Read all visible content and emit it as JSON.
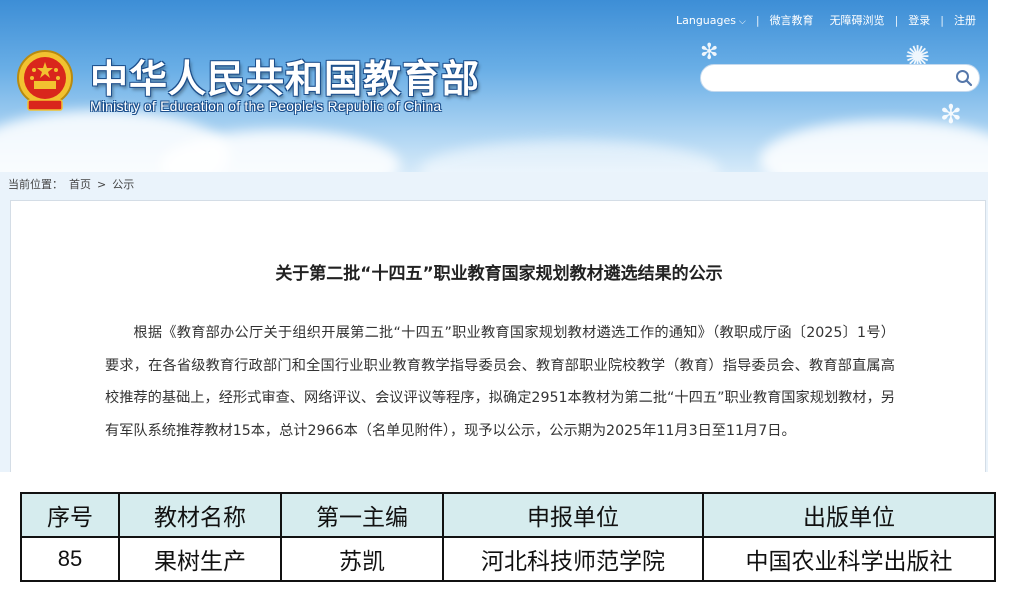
{
  "header": {
    "site_title": "中华人民共和国教育部",
    "site_subtitle": "Ministry of Education of the People's Republic of China",
    "nav": {
      "languages": "Languages",
      "weibo": "微言教育",
      "accessibility": "无障碍浏览",
      "login": "登录",
      "register": "注册"
    },
    "search": {
      "placeholder": ""
    }
  },
  "breadcrumb": {
    "label": "当前位置：",
    "home": "首页",
    "separator": ">",
    "current": "公示"
  },
  "article": {
    "title": "关于第二批“十四五”职业教育国家规划教材遴选结果的公示",
    "body": "根据《教育部办公厅关于组织开展第二批“十四五”职业教育国家规划教材遴选工作的通知》（教职成厅函〔2025〕1号）要求，在各省级教育行政部门和全国行业职业教育教学指导委员会、教育部职业院校教学（教育）指导委员会、教育部直属高校推荐的基础上，经形式审查、网络评议、会议评议等程序，拟确定2951本教材为第二批“十四五”职业教育国家规划教材，另有军队系统推荐教材15本，总计2966本（名单见附件），现予以公示，公示期为2025年11月3日至11月7日。"
  },
  "table": {
    "headers": [
      "序号",
      "教材名称",
      "第一主编",
      "申报单位",
      "出版单位"
    ],
    "rows": [
      [
        "85",
        "果树生产",
        "苏凯",
        "河北科技师范学院",
        "中国农业科学出版社"
      ]
    ]
  },
  "colors": {
    "header_blue": "#3d8ed6",
    "table_header_bg": "#d6ecee",
    "emblem_red": "#d9261c",
    "emblem_gold": "#f2c230"
  },
  "icons": {
    "emblem": "national-emblem-icon",
    "search": "search-icon",
    "chevron": "chevron-down-icon"
  }
}
